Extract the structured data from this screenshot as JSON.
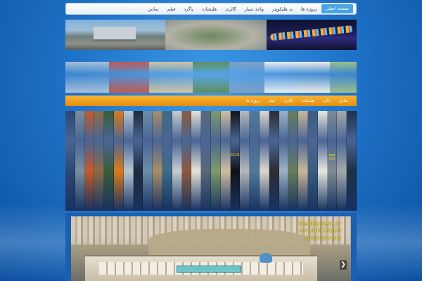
{
  "topnav": {
    "items": [
      "صفحه اصلی",
      "پروژه ها",
      "پد هلیکوپتر",
      "واحد سیار",
      "گالری",
      "هلیشات",
      "پاگرد",
      "فیلم",
      "تماس"
    ]
  },
  "orangenav": {
    "items": [
      "تماس",
      "پاگرد",
      "هلیشات",
      "گالری",
      "فیلم",
      "پروژه ها"
    ]
  },
  "banner_row1": [
    "#8eb5d6",
    "#90a083",
    "#1b1f52"
  ],
  "banner_row2": [
    "#a7bfd8",
    "#c25a52",
    "#d1c3a2",
    "#5f8f5e",
    "#7ea0c7",
    "#e9edf3",
    "#f0ece4",
    "#9bc08a"
  ],
  "slices": [
    {
      "color": "#2d4775"
    },
    {
      "color": "#7a8f9e"
    },
    {
      "color": "#c45a2c"
    },
    {
      "color": "#8a6d45"
    },
    {
      "color": "#3a5c3b"
    },
    {
      "color": "#d97b1c"
    },
    {
      "color": "#b7c7d3"
    },
    {
      "color": "#1d2a3c"
    },
    {
      "color": "#6e8da8"
    },
    {
      "color": "#a98d6b"
    },
    {
      "color": "#3b6d87"
    },
    {
      "color": "#c7cbcf"
    },
    {
      "color": "#8e5b3b"
    },
    {
      "color": "#e7e2d6"
    },
    {
      "color": "#59687a"
    },
    {
      "color": "#7f9a6a"
    },
    {
      "color": "#d0bfa1"
    },
    {
      "color": "#101418",
      "text": "0119"
    },
    {
      "color": "#b5b8bb"
    },
    {
      "color": "#4f7a9c"
    },
    {
      "color": "#dcd8d0"
    },
    {
      "color": "#2d2d33"
    },
    {
      "color": "#9bb2c4"
    },
    {
      "color": "#6a7c58"
    },
    {
      "color": "#c9b79b"
    },
    {
      "color": "#3b5d7f"
    },
    {
      "color": "#e8e6e0"
    },
    {
      "color": "#7d8b93",
      "text": "kop 302"
    },
    {
      "color": "#a5a9ad"
    },
    {
      "color": "#1f3048"
    }
  ],
  "aerial": {
    "caption": [
      "Helikopters.ir",
      "09190028229",
      "Helisht.com"
    ]
  }
}
